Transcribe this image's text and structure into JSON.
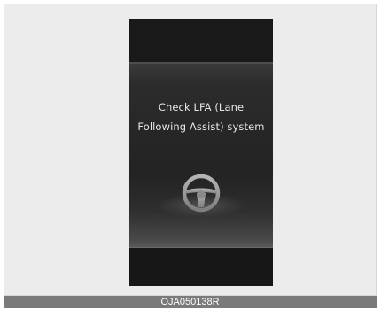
{
  "cluster_display": {
    "message_line1": "Check LFA (Lane",
    "message_line2": "Following Assist) system",
    "icon": "steering-wheel-icon"
  },
  "figure_caption": "OJA050138R",
  "colors": {
    "display_background": "#1a1a1a",
    "text": "#e8e8e8",
    "icon": "#9a9a9a",
    "caption_bar": "#7a7a7a"
  }
}
